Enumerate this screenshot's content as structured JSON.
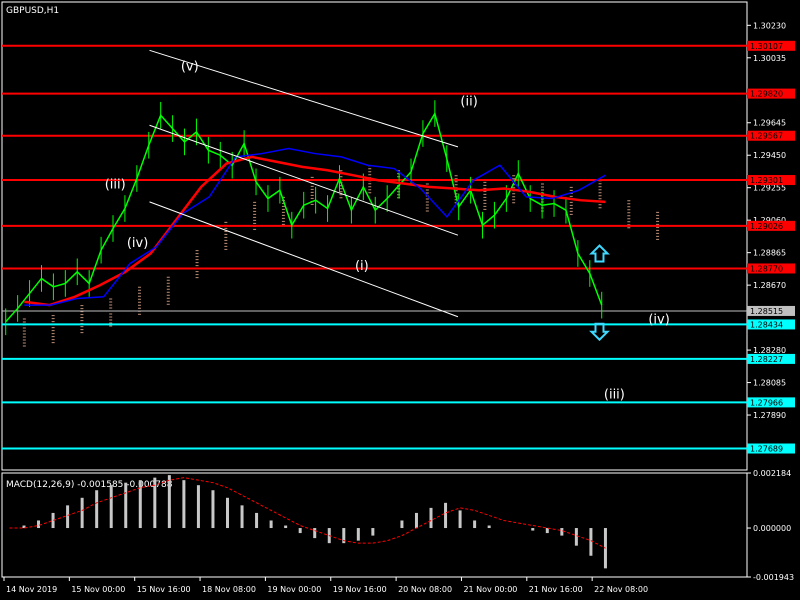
{
  "chart_data": {
    "type": "line",
    "symbol_timeframe": "GBPUSD,H1",
    "price_axis": {
      "ylim": [
        1.2756,
        1.3037
      ],
      "ticks": [
        "1.30230",
        "1.30035",
        "1.29645",
        "1.29450",
        "1.29255",
        "1.29060",
        "1.28865",
        "1.28670",
        "1.28280",
        "1.28085",
        "1.27890"
      ]
    },
    "time_axis": {
      "labels": [
        "14 Nov 2019",
        "15 Nov 00:00",
        "15 Nov 16:00",
        "18 Nov 08:00",
        "19 Nov 00:00",
        "19 Nov 16:00",
        "20 Nov 08:00",
        "21 Nov 00:00",
        "21 Nov 16:00",
        "22 Nov 08:00"
      ]
    },
    "resistance_levels": [
      {
        "price": 1.30107,
        "label": "1.30107"
      },
      {
        "price": 1.2982,
        "label": "1.29820"
      },
      {
        "price": 1.29567,
        "label": "1.29567"
      },
      {
        "price": 1.29301,
        "label": "1.29301"
      },
      {
        "price": 1.29026,
        "label": "1.29026"
      },
      {
        "price": 1.2877,
        "label": "1.28770"
      }
    ],
    "support_levels": [
      {
        "price": 1.28434,
        "label": "1.28434"
      },
      {
        "price": 1.28227,
        "label": "1.28227"
      },
      {
        "price": 1.27966,
        "label": "1.27966"
      },
      {
        "price": 1.27689,
        "label": "1.27689"
      }
    ],
    "current_price": {
      "price": 1.28515,
      "label": "1.28515"
    },
    "price_series": [
      1.2845,
      1.2853,
      1.2862,
      1.2871,
      1.2866,
      1.2868,
      1.2875,
      1.2868,
      1.2888,
      1.2901,
      1.2913,
      1.2931,
      1.2951,
      1.2969,
      1.2961,
      1.2953,
      1.2959,
      1.2948,
      1.2945,
      1.2939,
      1.2952,
      1.2929,
      1.2919,
      1.2924,
      1.2903,
      1.2915,
      1.2918,
      1.2913,
      1.2931,
      1.2912,
      1.2926,
      1.2912,
      1.2919,
      1.2927,
      1.2935,
      1.2958,
      1.297,
      1.2943,
      1.2914,
      1.2924,
      1.2903,
      1.2909,
      1.2919,
      1.2934,
      1.2919,
      1.2915,
      1.2916,
      1.2912,
      1.2886,
      1.2874,
      1.2855
    ],
    "series": [
      {
        "values": [
          1.2857,
          1.2855,
          1.286,
          1.2867,
          1.2875,
          1.2886,
          1.2906,
          1.2926,
          1.294,
          1.2944,
          1.2941,
          1.2938,
          1.2936,
          1.2933,
          1.293,
          1.2928,
          1.2926,
          1.2925,
          1.2924,
          1.2925,
          1.2923,
          1.292,
          1.2918,
          1.2917
        ]
      },
      {
        "values": [
          1.2855,
          1.2855,
          1.2859,
          1.286,
          1.288,
          1.289,
          1.291,
          1.292,
          1.2944,
          1.2946,
          1.2949,
          1.2946,
          1.2944,
          1.2939,
          1.2937,
          1.2925,
          1.2908,
          1.293,
          1.2939,
          1.292,
          1.2919,
          1.2924,
          1.2933
        ]
      }
    ],
    "cloud_values": [
      1.2847,
      1.2849,
      1.2855,
      1.2859,
      1.2866,
      1.2872,
      1.2888,
      1.2905,
      1.2917,
      1.292,
      1.2932,
      1.2936,
      1.2939,
      1.2936,
      1.2928,
      1.2933,
      1.2929,
      1.2933,
      1.2928,
      1.2926,
      1.293,
      1.2918,
      1.2911
    ],
    "channel_lines": [
      {
        "from": [
          0.198,
          1.3008
        ],
        "to": [
          0.612,
          1.295
        ]
      },
      {
        "from": [
          0.198,
          1.2963
        ],
        "to": [
          0.612,
          1.2897
        ]
      },
      {
        "from": [
          0.198,
          1.2917
        ],
        "to": [
          0.612,
          1.2848
        ]
      }
    ],
    "annotations": [
      {
        "text": "(v)",
        "x": 0.252,
        "price": 1.2996
      },
      {
        "text": "(iii)",
        "x": 0.152,
        "price": 1.2925
      },
      {
        "text": "(iv)",
        "x": 0.182,
        "price": 1.289
      },
      {
        "text": "(ii)",
        "x": 0.627,
        "price": 1.2975
      },
      {
        "text": "(i)",
        "x": 0.483,
        "price": 1.2876
      },
      {
        "text": "(iv)",
        "x": 0.882,
        "price": 1.2844
      },
      {
        "text": "(iii)",
        "x": 0.822,
        "price": 1.2799
      }
    ],
    "arrows": [
      {
        "direction": "up",
        "x": 0.802,
        "price": 1.2886,
        "color": "#3fd8ff"
      },
      {
        "direction": "down",
        "x": 0.802,
        "price": 1.2839,
        "color": "#3fd8ff"
      }
    ],
    "macd": {
      "label": "MACD(12,26,9) -0.001585 -0.000788",
      "ticks": [
        "0.002184",
        "0.000000",
        "-0.001943"
      ],
      "ylim": [
        -0.001943,
        0.002184
      ],
      "histogram": [
        0.0,
        0.0001,
        0.0003,
        0.0006,
        0.0009,
        0.0012,
        0.0015,
        0.0017,
        0.0018,
        0.0019,
        0.002,
        0.0021,
        0.0019,
        0.0017,
        0.0015,
        0.0012,
        0.0009,
        0.0006,
        0.0003,
        0.0001,
        -0.0002,
        -0.0004,
        -0.0006,
        -0.0006,
        -0.0005,
        -0.0003,
        0.0,
        0.0003,
        0.0006,
        0.0008,
        0.001,
        0.0007,
        0.0003,
        0.0001,
        0.0,
        0.0,
        -0.0001,
        -0.0002,
        -0.0003,
        -0.0007,
        -0.0011,
        -0.0016
      ],
      "signal": [
        0.0,
        0.0,
        0.0001,
        0.0003,
        0.0005,
        0.0007,
        0.001,
        0.0012,
        0.0014,
        0.0016,
        0.0017,
        0.0019,
        0.002,
        0.0019,
        0.0018,
        0.0016,
        0.0013,
        0.001,
        0.0007,
        0.0004,
        0.0001,
        -0.0001,
        -0.0003,
        -0.0005,
        -0.0006,
        -0.0006,
        -0.0005,
        -0.0003,
        0.0,
        0.0003,
        0.0006,
        0.0008,
        0.0007,
        0.0005,
        0.0003,
        0.0002,
        0.0001,
        0.0,
        -0.0001,
        -0.0003,
        -0.0005,
        -0.0008
      ]
    },
    "colors": {
      "background": "#000000",
      "candle": "#00ff00",
      "resistance": "#ff0000",
      "support": "#00ffff",
      "current": "#c0c0c0",
      "ma_red": "#ff0000",
      "ma_blue": "#0000ff",
      "channel": "#ffffff",
      "cloud": "#ffc0a0"
    }
  }
}
